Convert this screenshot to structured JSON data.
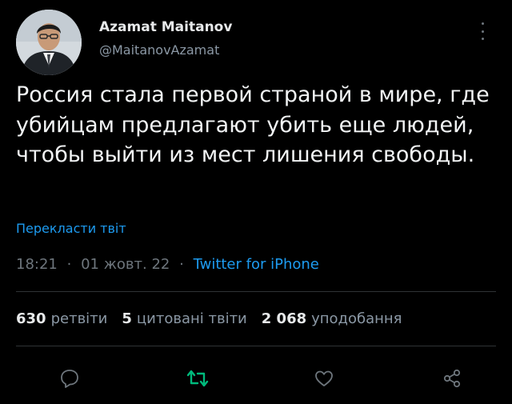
{
  "author": {
    "display_name": "Azamat Maitanov",
    "handle": "@MaitanovAzamat"
  },
  "tweet": {
    "text": "Россия стала первой страной в мире, где убийцам предлагают убить еще людей, чтобы выйти из мест лишения свободы.",
    "translate_link": "Перекласти твіт"
  },
  "meta": {
    "time": "18:21",
    "separator": "·",
    "date": "01 жовт. 22",
    "source": "Twitter for iPhone"
  },
  "stats": {
    "retweets": {
      "count": "630",
      "label": "ретвіти"
    },
    "quotes": {
      "count": "5",
      "label": "цитовані твіти"
    },
    "likes": {
      "count": "2 068",
      "label": "уподобання"
    }
  },
  "icons": {
    "reply": "reply-icon",
    "retweet": "retweet-icon",
    "like": "heart-icon",
    "share": "share-icon",
    "more": "more-icon"
  },
  "colors": {
    "background": "#000000",
    "accent": "#1d9bf0",
    "retweet_green": "#00ba7c",
    "muted": "#6e767d"
  }
}
